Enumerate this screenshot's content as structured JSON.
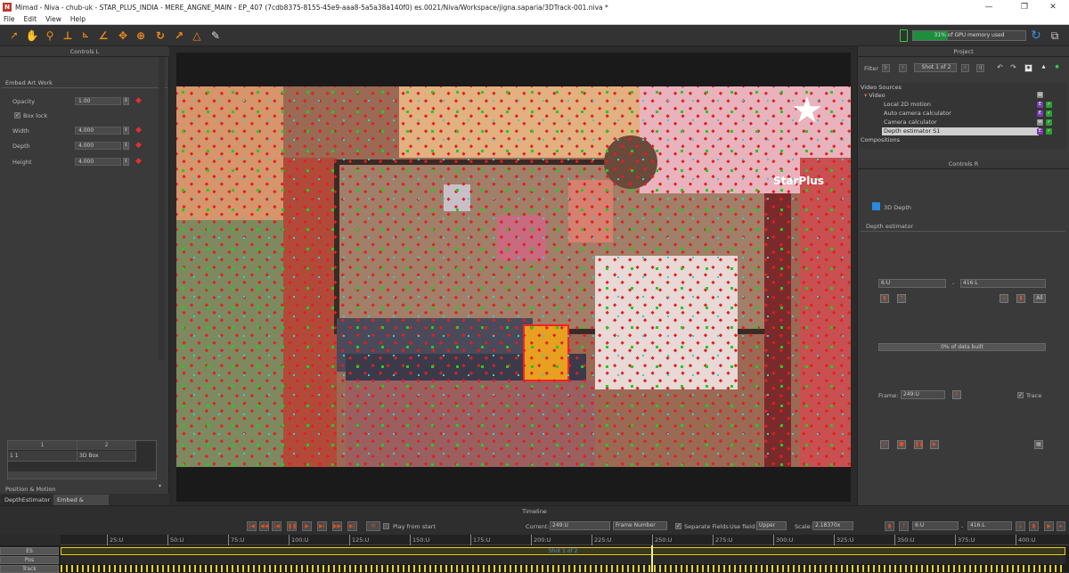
{
  "window": {
    "title": "Mimad - Niva - chub-uk - STAR_PLUS_INDIA - MERE_ANGNE_MAIN - EP_407 (7cdb8375-8155-45e9-aaa8-5a5a38a140f0) es.0021/Niva/Workspace/jigna.saparia/3DTrack-001.niva *",
    "minimize": "—",
    "maximize": "❐",
    "close": "✕"
  },
  "menu": [
    "File",
    "Edit",
    "View",
    "Help"
  ],
  "toolbar": {
    "gpu_label": "31% of GPU memory used",
    "gpu_fraction": 0.31
  },
  "left_panel": {
    "title": "Controls L",
    "section": "Embed Art Work",
    "opacity_label": "Opacity",
    "opacity_value": "1.00",
    "boxlock_label": "Box lock",
    "width_label": "Width",
    "width_value": "4.000",
    "depth_label": "Depth",
    "depth_value": "4.000",
    "height_label": "Height",
    "height_value": "4.000",
    "table": {
      "headers": [
        "1",
        "2"
      ],
      "row": [
        "1 1",
        "3D Box"
      ]
    },
    "position_motion": "Position & Motion",
    "tabs": [
      "DepthEstimator",
      "Embed & Position"
    ]
  },
  "viewer": {
    "logo_text": "StarPlus"
  },
  "right_panel": {
    "project_title": "Project",
    "filter_label": "Filter",
    "shot_label": "Shot 1 of 2",
    "video_sources": "Video Sources",
    "video": "Video",
    "items": [
      "Local 2D motion",
      "Auto camera calculator",
      "Camera calculator",
      "Depth estimator S1"
    ],
    "compositions": "Compositions",
    "controls_r_title": "Controls R",
    "depth3d": "3D Depth",
    "depth_estimator": "Depth estimator",
    "range_start": "6:U",
    "range_end": "416:L",
    "all_label": "All",
    "data_built": "0% of data built",
    "frame_label": "Frame:",
    "frame_value": "249:U",
    "trace_label": "Trace"
  },
  "timeline": {
    "title": "Timeline",
    "play_from_start": "Play from start",
    "current_label": "Current:",
    "current_value": "249:U",
    "frame_number": "Frame Number",
    "separate_fields": "Separate Fields",
    "use_field_label": "Use field:",
    "use_field_value": "Upper",
    "scale_label": "Scale:",
    "scale_value": "2.18370x",
    "range_start": "6:U",
    "range_end": "416:L",
    "ticks": [
      "25:U",
      "50:U",
      "75:U",
      "100:U",
      "125:U",
      "150:U",
      "175:U",
      "200:U",
      "225:U",
      "250:U",
      "275:U",
      "300:U",
      "325:U",
      "350:U",
      "375:U",
      "400:U"
    ],
    "track_labels": [
      "ES",
      "Pos",
      "Track"
    ],
    "shot_bar": "Shot 1 of 2"
  },
  "colors": {
    "accent": "#f08a1c",
    "gpu": "#1e8e3e",
    "selected": "#5b5b5b"
  }
}
